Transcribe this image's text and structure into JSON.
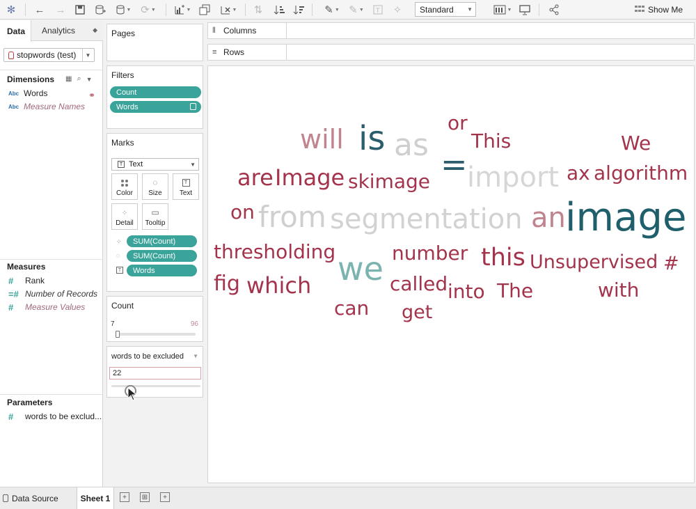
{
  "toolbar": {
    "view_mode": "Standard",
    "show_me_label": "Show Me"
  },
  "data_pane": {
    "tabs": [
      "Data",
      "Analytics"
    ],
    "datasource": "stopwords (test)",
    "dimensions_header": "Dimensions",
    "dimensions": [
      {
        "type": "Abc",
        "name": "Words"
      },
      {
        "type": "Abc",
        "name": "Measure Names"
      }
    ],
    "measures_header": "Measures",
    "measures": [
      {
        "name": "Rank"
      },
      {
        "name": "Number of Records"
      },
      {
        "name": "Measure Values"
      }
    ],
    "parameters_header": "Parameters",
    "parameters": [
      {
        "name": "words to be exclud..."
      }
    ]
  },
  "pages_card": {
    "title": "Pages"
  },
  "filters_card": {
    "title": "Filters",
    "pills": [
      "Count",
      "Words"
    ]
  },
  "marks_card": {
    "title": "Marks",
    "mark_type": "Text",
    "buttons": [
      "Color",
      "Size",
      "Text",
      "Detail",
      "Tooltip"
    ],
    "fields": [
      "SUM(Count)",
      "SUM(Count)",
      "Words"
    ]
  },
  "count_filter": {
    "title": "Count",
    "min": "7",
    "max": "96"
  },
  "parameter_control": {
    "title": "words to be excluded",
    "value": "22"
  },
  "shelves": {
    "columns": "Columns",
    "rows": "Rows"
  },
  "colors": {
    "teal": "#3aa39a",
    "word_dark": "#9c2340",
    "word_teal": "#1f5f6b"
  },
  "word_cloud": [
    {
      "text": "will",
      "color": "#c0848f"
    },
    {
      "text": "is",
      "color": "#2b5e6c"
    },
    {
      "text": "as",
      "color": "#cfcfcf"
    },
    {
      "text": "or",
      "color": "#a3344c"
    },
    {
      "text": "This",
      "color": "#a3344c"
    },
    {
      "text": "We",
      "color": "#a3344c"
    },
    {
      "text": "=",
      "color": "#2b5e6c"
    },
    {
      "text": "import",
      "color": "#d6d6d6"
    },
    {
      "text": "are",
      "color": "#a3344c"
    },
    {
      "text": "Image",
      "color": "#a3344c"
    },
    {
      "text": "skimage",
      "color": "#a3344c"
    },
    {
      "text": "ax",
      "color": "#a3344c"
    },
    {
      "text": "algorithm",
      "color": "#a3344c"
    },
    {
      "text": "on",
      "color": "#a3344c"
    },
    {
      "text": "from",
      "color": "#cfcfcf"
    },
    {
      "text": "segmentation",
      "color": "#d2d2d2"
    },
    {
      "text": "an",
      "color": "#c0848f"
    },
    {
      "text": "image",
      "color": "#1f5f6b"
    },
    {
      "text": "thresholding",
      "color": "#a3344c"
    },
    {
      "text": "we",
      "color": "#7bb3ae"
    },
    {
      "text": "number",
      "color": "#a3344c"
    },
    {
      "text": "this",
      "color": "#a3344c"
    },
    {
      "text": "Unsupervised",
      "color": "#a3344c"
    },
    {
      "text": "#",
      "color": "#a3344c"
    },
    {
      "text": "fig",
      "color": "#a3344c"
    },
    {
      "text": "which",
      "color": "#a3344c"
    },
    {
      "text": "called",
      "color": "#a3344c"
    },
    {
      "text": "into",
      "color": "#a3344c"
    },
    {
      "text": "The",
      "color": "#a3344c"
    },
    {
      "text": "with",
      "color": "#a3344c"
    },
    {
      "text": "can",
      "color": "#a3344c"
    },
    {
      "text": "get",
      "color": "#a3344c"
    }
  ],
  "bottom_tabs": {
    "data_source": "Data Source",
    "sheet": "Sheet 1"
  }
}
